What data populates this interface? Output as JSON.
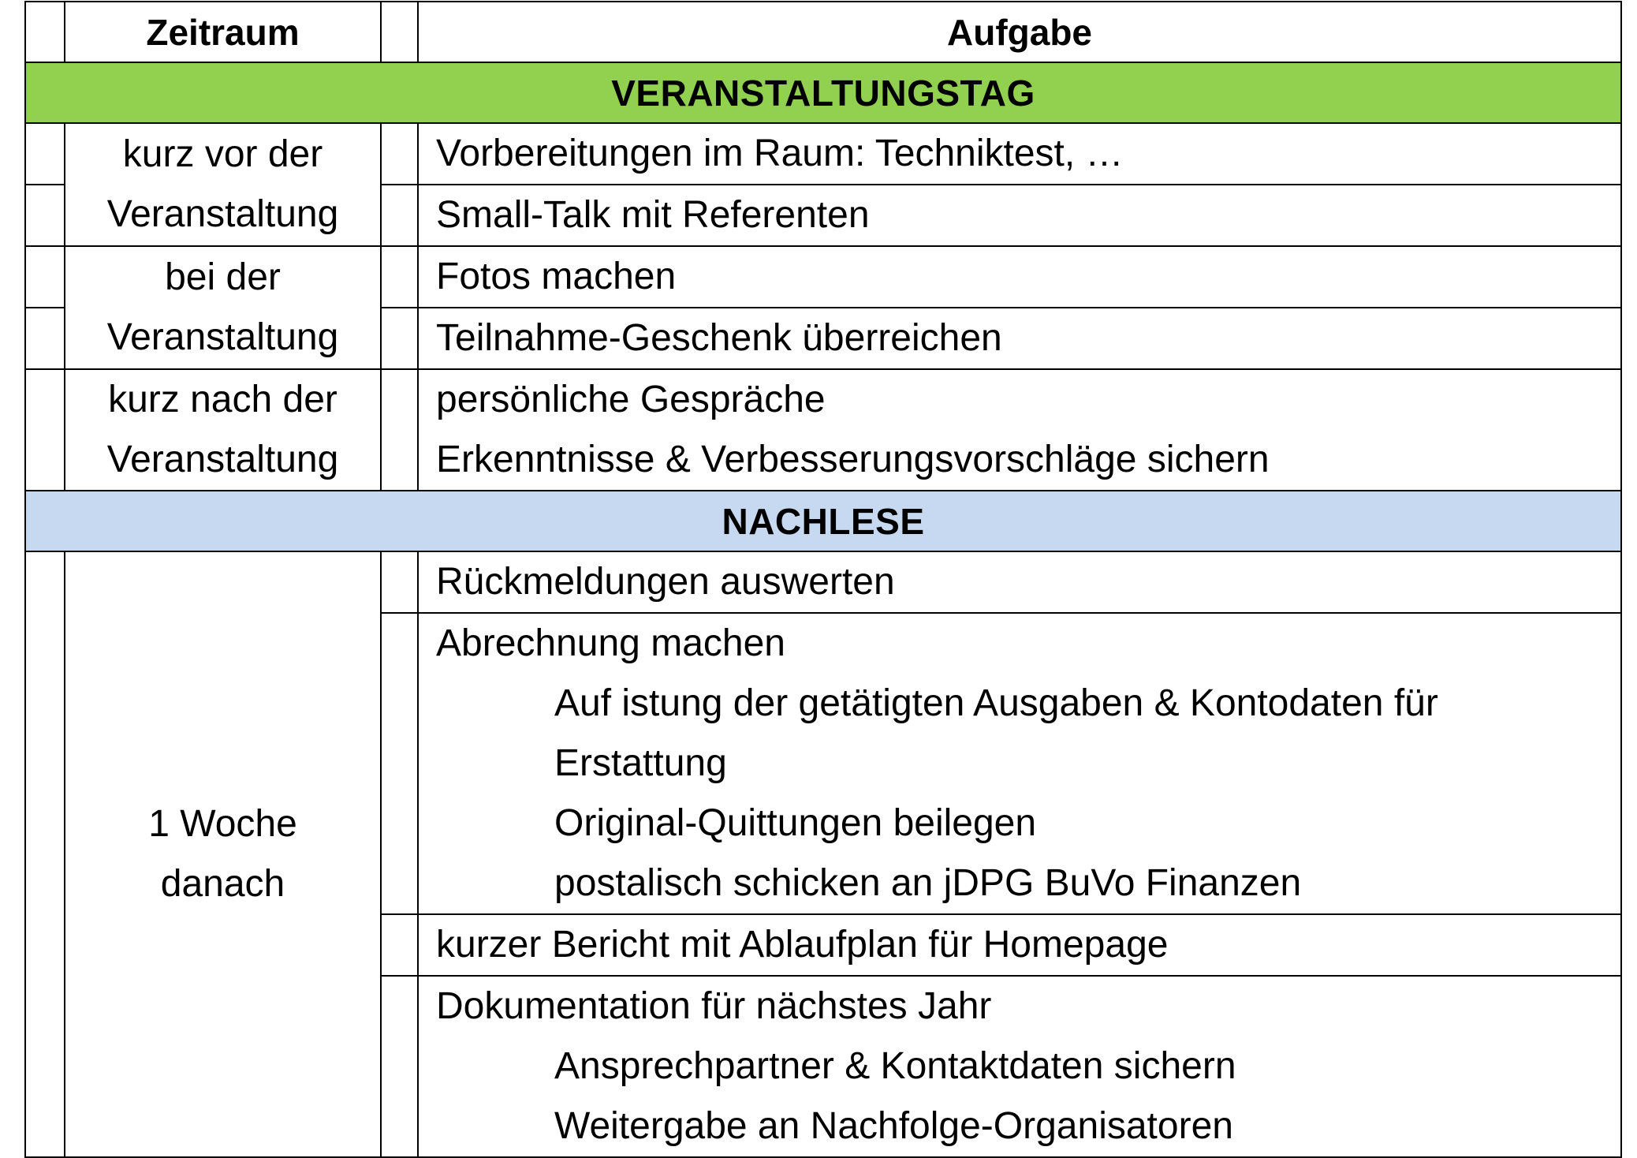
{
  "header": {
    "zeitraum": "Zeitraum",
    "aufgabe": "Aufgabe"
  },
  "sections": {
    "veranstaltungstag": {
      "title": "VERANSTALTUNGSTAG",
      "color": "#92d050",
      "groups": [
        {
          "zeitraum": [
            "kurz vor der",
            "Veranstaltung"
          ],
          "tasks": [
            "Vorbereitungen im Raum: Techniktest, …",
            "Small-Talk mit Referenten"
          ]
        },
        {
          "zeitraum": [
            "bei der",
            "Veranstaltung"
          ],
          "tasks": [
            "Fotos machen",
            "Teilnahme-Geschenk überreichen"
          ]
        },
        {
          "zeitraum": [
            "kurz nach der",
            "Veranstaltung"
          ],
          "tasks": [
            "persönliche Gespräche",
            "Erkenntnisse & Verbesserungsvorschläge sichern"
          ]
        }
      ]
    },
    "nachlese": {
      "title": "NACHLESE",
      "color": "#c6d9f1",
      "zeitraum": [
        "1 Woche",
        "danach"
      ],
      "tasks": [
        {
          "text": "Rückmeldungen auswerten",
          "sub": []
        },
        {
          "text": "Abrechnung machen",
          "sub": [
            "Auf istung der getätigten Ausgaben & Kontodaten für",
            "Erstattung",
            "Original-Quittungen beilegen",
            "postalisch schicken an jDPG BuVo Finanzen"
          ]
        },
        {
          "text": "kurzer Bericht mit Ablaufplan für Homepage",
          "sub": []
        },
        {
          "text": "Dokumentation für nächstes Jahr",
          "sub": [
            "Ansprechpartner & Kontaktdaten sichern",
            "Weitergabe an Nachfolge-Organisatoren"
          ]
        }
      ]
    }
  }
}
